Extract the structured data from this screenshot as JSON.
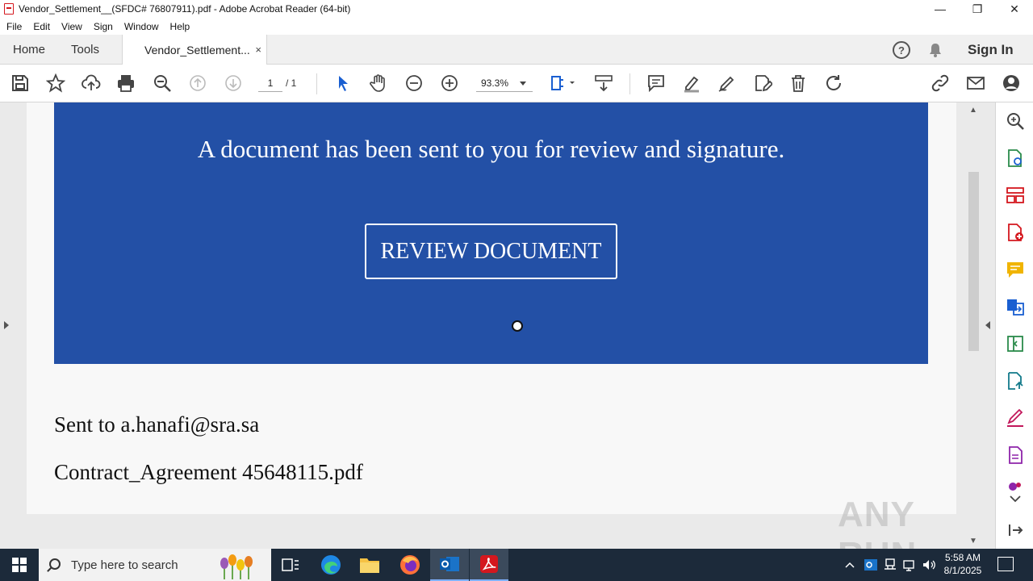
{
  "window": {
    "title": "Vendor_Settlement__(SFDC# 76807911).pdf - Adobe Acrobat Reader (64-bit)",
    "controls": [
      "—",
      "❐",
      "✕"
    ]
  },
  "menu": [
    "File",
    "Edit",
    "View",
    "Sign",
    "Window",
    "Help"
  ],
  "tabs": {
    "home": "Home",
    "tools": "Tools",
    "document": "Vendor_Settlement...",
    "close": "×",
    "sign_in": "Sign In",
    "help": "?"
  },
  "toolbar": {
    "page_current": "1",
    "page_total": "/ 1",
    "zoom": "93.3%"
  },
  "document": {
    "banner_text": "A document has been sent to you for review and signature.",
    "button_label": "REVIEW DOCUMENT",
    "sent_to": "Sent to a.hanafi@sra.sa",
    "attachment": "Contract_Agreement 45648115.pdf",
    "banner_color": "#2350a6"
  },
  "watermark": "ANY RUN",
  "taskbar": {
    "search_placeholder": "Type here to search",
    "time": "5:58 AM",
    "date": "8/1/2025"
  }
}
